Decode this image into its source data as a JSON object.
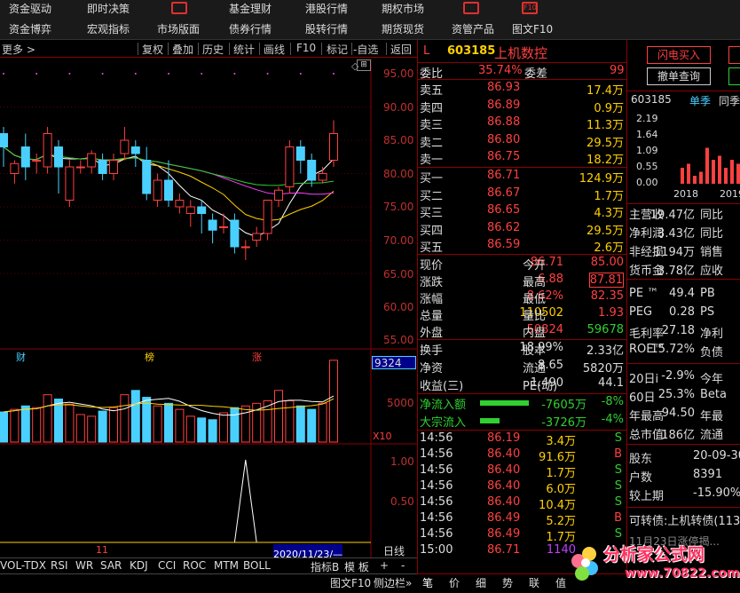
{
  "topbar": {
    "items": [
      {
        "label": "资金驱动"
      },
      {
        "label": "即时决策"
      },
      {
        "label": "基金理财"
      },
      {
        "label": "港股行情"
      },
      {
        "label": "期权市场"
      },
      {
        "label": "资金博弈"
      },
      {
        "label": "宏观指标"
      },
      {
        "label": "市场版面"
      },
      {
        "label": "债券行情"
      },
      {
        "label": "股转行情"
      },
      {
        "label": "期货现货"
      },
      {
        "label": "资管产品"
      },
      {
        "label": "图文F10"
      }
    ]
  },
  "toolbar": {
    "more": "更多 >",
    "items": [
      "复权",
      "叠加",
      "历史",
      "统计",
      "画线",
      "F10",
      "标记",
      "-自选",
      "返回"
    ]
  },
  "chart": {
    "price_axis": [
      "95.00",
      "90.00",
      "85.00",
      "80.00",
      "75.00",
      "70.00",
      "65.00",
      "60.00",
      "55.00"
    ],
    "markers": [
      "财",
      "榜",
      "涨"
    ],
    "volume_label": "9324",
    "volume_axis": [
      "5000"
    ],
    "volume_unit": "X10",
    "indicator_axis": [
      "1.00",
      "0.50"
    ],
    "date_label": "11",
    "date_cursor": "2020/11/23/—",
    "period": "日线",
    "candles": [
      {
        "o": 86,
        "c": 84,
        "h": 87,
        "l": 81
      },
      {
        "o": 80,
        "c": 81.5,
        "h": 82,
        "l": 78.5
      },
      {
        "o": 84,
        "c": 81,
        "h": 86,
        "l": 79
      },
      {
        "o": 82,
        "c": 82,
        "h": 83,
        "l": 80
      },
      {
        "o": 81,
        "c": 86,
        "h": 87,
        "l": 80
      },
      {
        "o": 84,
        "c": 81,
        "h": 85,
        "l": 77
      },
      {
        "o": 76,
        "c": 81,
        "h": 82,
        "l": 75
      },
      {
        "o": 81,
        "c": 81,
        "h": 82,
        "l": 80
      },
      {
        "o": 81,
        "c": 83,
        "h": 83.5,
        "l": 80
      },
      {
        "o": 82,
        "c": 80,
        "h": 83,
        "l": 79
      },
      {
        "o": 80,
        "c": 82,
        "h": 83,
        "l": 79
      },
      {
        "o": 83,
        "c": 85,
        "h": 87,
        "l": 82
      },
      {
        "o": 84,
        "c": 83,
        "h": 85,
        "l": 81
      },
      {
        "o": 82,
        "c": 77,
        "h": 84,
        "l": 76
      },
      {
        "o": 76,
        "c": 79,
        "h": 80,
        "l": 75
      },
      {
        "o": 79,
        "c": 76,
        "h": 82,
        "l": 75
      },
      {
        "o": 75,
        "c": 76,
        "h": 77,
        "l": 74
      },
      {
        "o": 74,
        "c": 75,
        "h": 76,
        "l": 72
      },
      {
        "o": 75,
        "c": 74,
        "h": 76,
        "l": 71
      },
      {
        "o": 73,
        "c": 71.5,
        "h": 74,
        "l": 69.5
      },
      {
        "o": 72,
        "c": 72,
        "h": 74,
        "l": 71
      },
      {
        "o": 73,
        "c": 69,
        "h": 74,
        "l": 68
      },
      {
        "o": 69,
        "c": 69,
        "h": 70,
        "l": 67
      },
      {
        "o": 70,
        "c": 71,
        "h": 72,
        "l": 69
      },
      {
        "o": 71,
        "c": 76,
        "h": 76,
        "l": 70
      },
      {
        "o": 76,
        "c": 77.5,
        "h": 78,
        "l": 75
      },
      {
        "o": 78,
        "c": 84,
        "h": 85,
        "l": 77
      },
      {
        "o": 84,
        "c": 82,
        "h": 85,
        "l": 80
      },
      {
        "o": 82,
        "c": 79,
        "h": 83,
        "l": 78
      },
      {
        "o": 79,
        "c": 80,
        "h": 81,
        "l": 78.5
      },
      {
        "o": 82,
        "c": 86,
        "h": 88,
        "l": 81
      }
    ],
    "volumes": [
      35,
      38,
      42,
      40,
      55,
      50,
      44,
      32,
      30,
      36,
      40,
      55,
      60,
      52,
      42,
      45,
      38,
      30,
      28,
      26,
      34,
      40,
      42,
      45,
      48,
      60,
      48,
      42,
      38,
      45,
      95
    ],
    "indicator": [
      0,
      0,
      0,
      0,
      0,
      0,
      0,
      0,
      0,
      0,
      0,
      0,
      0,
      0,
      0,
      0,
      0,
      0,
      0,
      0,
      0,
      0,
      1,
      0,
      0,
      0,
      0,
      0,
      0,
      0,
      0
    ],
    "colors": {
      "up": "#ff4040",
      "down": "#4ad0ff",
      "ma1": "#ffffff",
      "ma2": "#ffd000",
      "ma3": "#ff40ff",
      "ma4": "#30d030"
    }
  },
  "bottom_tabs": [
    "VOL-TDX",
    "RSI",
    "WR",
    "SAR",
    "KDJ",
    "CCI",
    "ROC",
    "MTM",
    "BOLL",
    "指标B",
    "模 板",
    "+",
    "-"
  ],
  "quote": {
    "marker": "L",
    "code": "603185",
    "name": "上机数控",
    "weibi_label": "委比",
    "weibi": "35.74%",
    "weicha_label": "委差",
    "weicha": "99",
    "asks": [
      {
        "label": "卖五",
        "price": "86.93",
        "vol": "17.4万"
      },
      {
        "label": "卖四",
        "price": "86.89",
        "vol": "0.9万"
      },
      {
        "label": "卖三",
        "price": "86.88",
        "vol": "11.3万"
      },
      {
        "label": "卖二",
        "price": "86.80",
        "vol": "29.5万"
      },
      {
        "label": "卖一",
        "price": "86.75",
        "vol": "18.2万"
      }
    ],
    "bids": [
      {
        "label": "买一",
        "price": "86.71",
        "vol": "124.9万"
      },
      {
        "label": "买二",
        "price": "86.67",
        "vol": "1.7万"
      },
      {
        "label": "买三",
        "price": "86.65",
        "vol": "4.3万"
      },
      {
        "label": "买四",
        "price": "86.62",
        "vol": "29.5万"
      },
      {
        "label": "买五",
        "price": "86.59",
        "vol": "2.6万"
      }
    ],
    "stats": [
      {
        "l1": "现价",
        "v1": "86.71",
        "l2": "今开",
        "v2": "85.00"
      },
      {
        "l1": "涨跌",
        "v1": "6.88",
        "l2": "最高",
        "v2": "87.81"
      },
      {
        "l1": "涨幅",
        "v1": "8.62%",
        "l2": "最低",
        "v2": "82.35"
      },
      {
        "l1": "总量",
        "v1": "110502",
        "l2": "量比",
        "v2": "1.93"
      },
      {
        "l1": "外盘",
        "v1": "50824",
        "l2": "内盘",
        "v2": "59678"
      }
    ],
    "stats2": [
      {
        "l1": "换手",
        "v1": "18.99%",
        "l2": "股本",
        "v2": "2.33亿"
      },
      {
        "l1": "净资",
        "v1": "8.65",
        "l2": "流通",
        "v2": "5820万"
      },
      {
        "l1": "收益(三)",
        "v1": "1.490",
        "l2": "PE(动)",
        "v2": "44.1"
      }
    ],
    "flows": [
      {
        "label": "净流入额",
        "value": "-7605万",
        "pct": "-8%",
        "bar": 0.5
      },
      {
        "label": "大宗流入",
        "value": "-3726万",
        "pct": "-4%",
        "bar": 0.2
      }
    ],
    "ticks": [
      {
        "t": "14:56",
        "p": "86.19",
        "v": "3.4万",
        "s": "S"
      },
      {
        "t": "14:56",
        "p": "86.40",
        "v": "91.6万",
        "s": "B"
      },
      {
        "t": "14:56",
        "p": "86.40",
        "v": "1.7万",
        "s": "S"
      },
      {
        "t": "14:56",
        "p": "86.40",
        "v": "6.0万",
        "s": "S"
      },
      {
        "t": "14:56",
        "p": "86.40",
        "v": "10.4万",
        "s": "S"
      },
      {
        "t": "14:56",
        "p": "86.49",
        "v": "5.2万",
        "s": "B"
      },
      {
        "t": "14:56",
        "p": "86.49",
        "v": "1.7万",
        "s": "S"
      },
      {
        "t": "15:00",
        "p": "86.71",
        "v": "1140",
        "s": ""
      }
    ],
    "tabs": [
      "图文F10",
      "侧边栏»",
      "笔",
      "价",
      "细",
      "势",
      "联",
      "值"
    ]
  },
  "side": {
    "buy_btn": "闪电买入",
    "cancel_btn": "撤单查询",
    "code": "603185",
    "mode": "单季",
    "mode2": "同季",
    "bar_axis": [
      "2.19",
      "1.64",
      "1.09",
      "0.55",
      "0.00"
    ],
    "bar_years": [
      "2018",
      "2019"
    ],
    "bars": [
      0.2,
      0.25,
      0.1,
      0.15,
      0.45,
      0.3,
      0.35,
      0.2,
      0.3,
      0.25
    ],
    "fund": [
      {
        "l": "主营收",
        "v": "19.47亿",
        "l2": "同比"
      },
      {
        "l": "净利润",
        "v": "3.43亿",
        "l2": "同比"
      },
      {
        "l": "非经损",
        "v": "1194万",
        "l2": "销售"
      },
      {
        "l": "货币金",
        "v": "3.78亿",
        "l2": "应收"
      }
    ],
    "fund2": [
      {
        "l": "PE ™",
        "v": "49.4",
        "l2": "PB"
      },
      {
        "l": "PEG",
        "v": "0.28",
        "l2": "PS"
      },
      {
        "l": "毛利率",
        "v": "27.18",
        "l2": "净利"
      },
      {
        "l": "ROE™",
        "v": "15.72%",
        "l2": "负债"
      }
    ],
    "fund3": [
      {
        "l": "20日i",
        "v": "-2.9%",
        "l2": "今年"
      },
      {
        "l": "60日",
        "v": "25.3%",
        "l2": "Beta"
      },
      {
        "l": "年最高",
        "v": "94.50",
        "l2": "年最"
      },
      {
        "l": "总市值i",
        "v": "186亿",
        "l2": "流通"
      }
    ],
    "holders": [
      {
        "l": "股东",
        "v": "20-09-30"
      },
      {
        "l": "户数",
        "v": "8391"
      },
      {
        "l": "较上期",
        "v": "-15.90%"
      }
    ],
    "bond": "可转债:上机转债(113",
    "news": "11月23日涨停揭..."
  },
  "watermark": {
    "title": "分析家公式网",
    "url": "www.70822.com"
  }
}
